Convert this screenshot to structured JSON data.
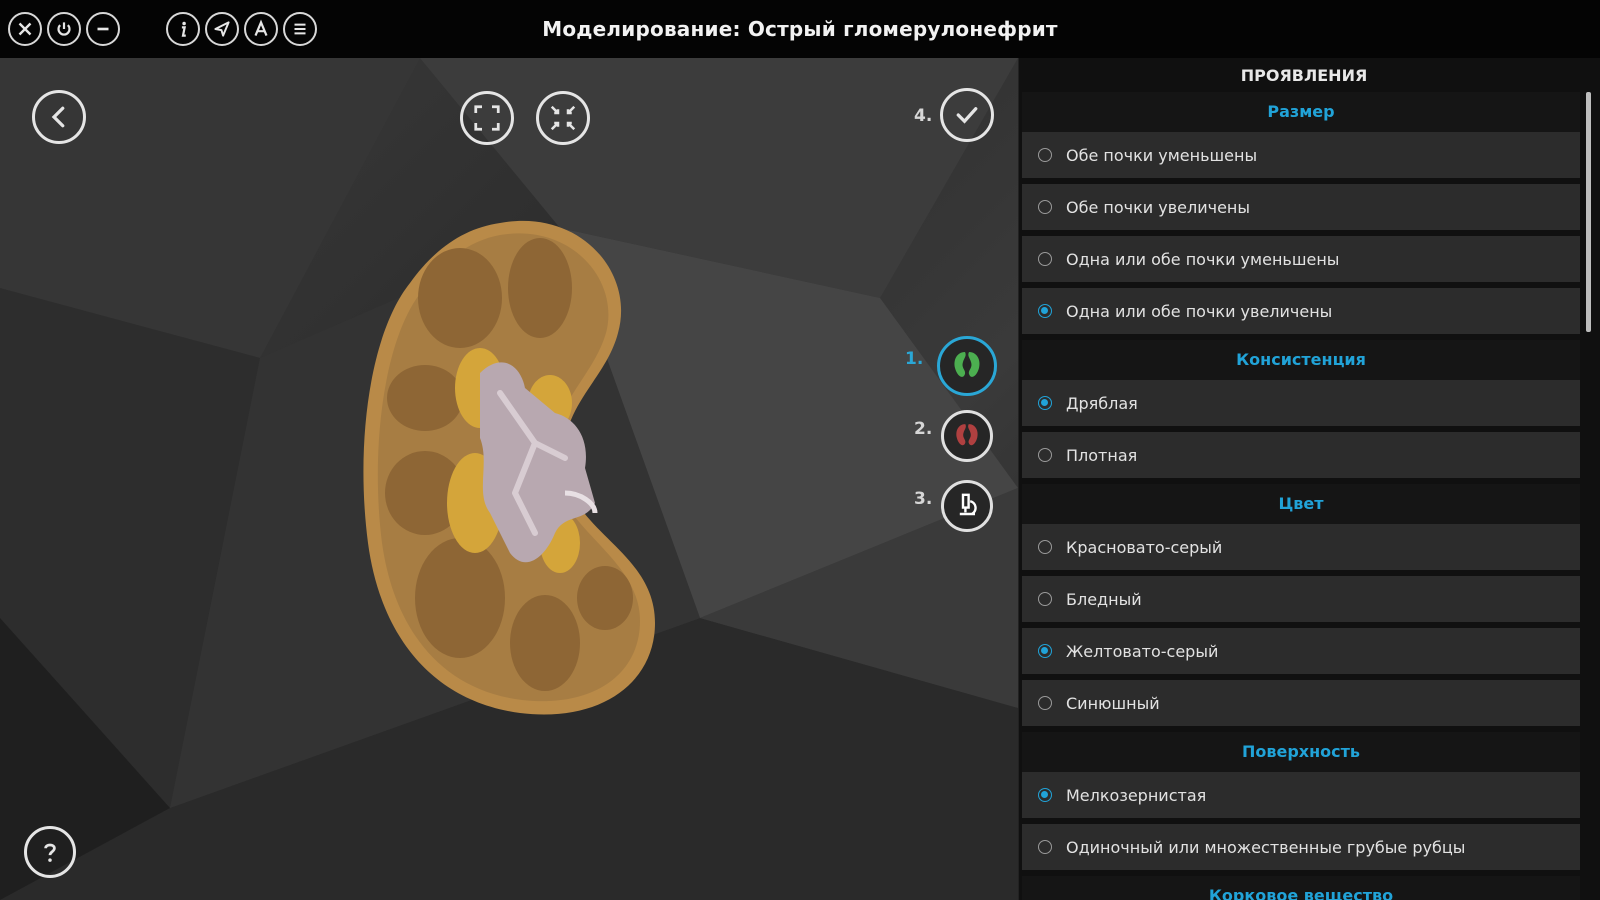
{
  "app": {
    "title": "Моделирование: Острый гломерулонефрит"
  },
  "titlebar_icons": [
    "close-icon",
    "power-icon",
    "minus-icon",
    "info-icon",
    "send-icon",
    "font-icon",
    "list-icon"
  ],
  "toolbar": {
    "fullscreen_icon": "expand-icon",
    "fit_icon": "fit-icon",
    "confirm_step_label": "4."
  },
  "steps": [
    {
      "label": "1.",
      "icon": "kidney-icon",
      "color": "#4caf50",
      "active": true
    },
    {
      "label": "2.",
      "icon": "kidney-icon",
      "color": "#b04040",
      "active": false
    },
    {
      "label": "3.",
      "icon": "microscope-icon",
      "color": "#ffffff",
      "active": false
    }
  ],
  "panel": {
    "title": "ПРОЯВЛЕНИЯ",
    "sections": [
      {
        "header": "Размер",
        "options": [
          {
            "label": "Обе почки уменьшены",
            "selected": false
          },
          {
            "label": "Обе почки увеличены",
            "selected": false
          },
          {
            "label": "Одна или обе почки уменьшены",
            "selected": false
          },
          {
            "label": "Одна или обе почки увеличены",
            "selected": true
          }
        ]
      },
      {
        "header": "Консистенция",
        "options": [
          {
            "label": "Дряблая",
            "selected": true
          },
          {
            "label": "Плотная",
            "selected": false
          }
        ]
      },
      {
        "header": "Цвет",
        "options": [
          {
            "label": "Красновато-серый",
            "selected": false
          },
          {
            "label": "Бледный",
            "selected": false
          },
          {
            "label": "Желтовато-серый",
            "selected": true
          },
          {
            "label": "Синюшный",
            "selected": false
          }
        ]
      },
      {
        "header": "Поверхность",
        "options": [
          {
            "label": "Мелкозернистая",
            "selected": true
          },
          {
            "label": "Одиночный или множественные грубые рубцы",
            "selected": false
          }
        ]
      },
      {
        "header": "Корковое вещество",
        "options": []
      }
    ]
  },
  "colors": {
    "accent": "#21a3d8",
    "panel_bg": "#101010",
    "option_bg": "#2c2c2c"
  }
}
